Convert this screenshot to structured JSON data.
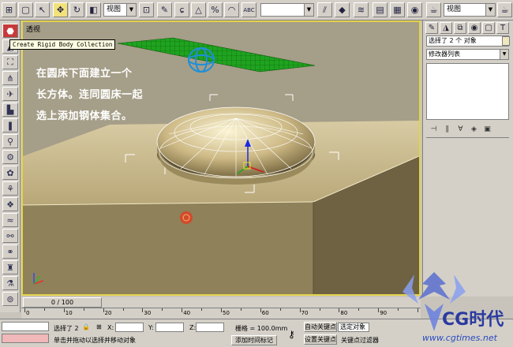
{
  "toolbar": {
    "view_dropdown": "视图",
    "abc_label": "ABC",
    "view_dropdown_right": "视图"
  },
  "tooltip": "Create Rigid Body Collection",
  "viewport": {
    "label": "透视",
    "caption_lines": [
      "在圆床下面建立一个",
      "长方体。连同圆床一起",
      "选上添加钢体集合。"
    ]
  },
  "right_panel": {
    "selection_text": "选择了 2 个 对象",
    "modifier_list": "修改器列表"
  },
  "timeline": {
    "slider_text": "0 / 100",
    "ruler_labels": [
      "0",
      "10",
      "20",
      "30",
      "40",
      "50",
      "60",
      "70",
      "80",
      "90"
    ]
  },
  "status": {
    "selected": "选择了 2",
    "x_label": "X:",
    "y_label": "Y:",
    "z_label": "Z:",
    "grid": "栅格 = 100.0mm",
    "auto_key": "自动关键点",
    "selected_objects": "选定对象",
    "set_key": "设置关键点",
    "key_filters": "关键点过滤器",
    "prompt": "单击并拖动以选择并移动对象",
    "add_time_tag": "添加时间标记"
  },
  "watermark": {
    "logo_text": "CG时代",
    "url": "www.cgtimes.net"
  },
  "colors": {
    "viewport_border": "#e2d34c",
    "ground": "#b9a67a",
    "mesh_green": "#1fa31f",
    "mesh_sphere_blue": "#1e8fd8",
    "marker_red": "#d24a2a",
    "caption": "#ffffff"
  }
}
